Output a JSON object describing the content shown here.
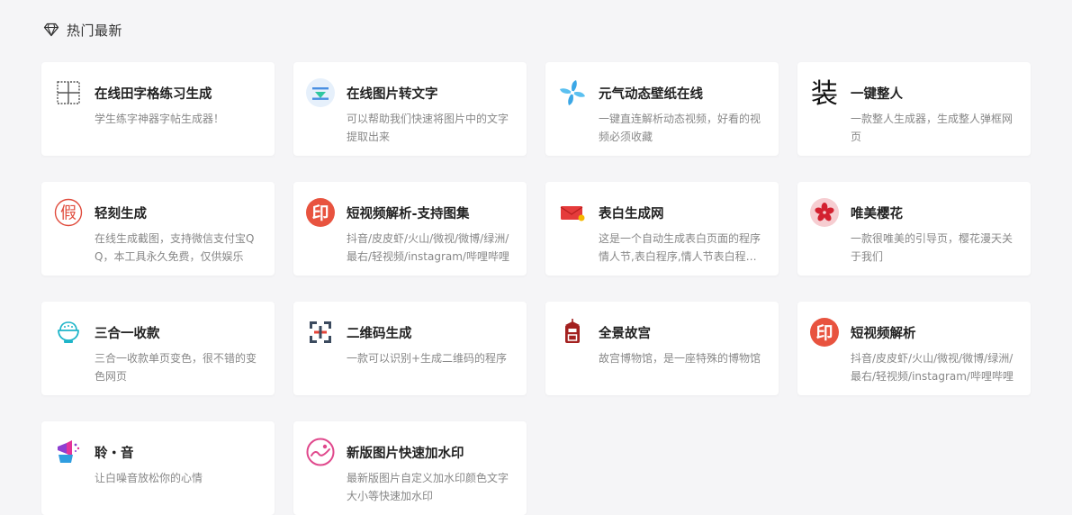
{
  "section": {
    "title": "热门最新",
    "icon": "diamond-icon"
  },
  "cards": [
    {
      "title": "在线田字格练习生成",
      "desc": "学生练字神器字帖生成器！",
      "icon": "grid-paper-icon"
    },
    {
      "title": "在线图片转文字",
      "desc": "可以帮助我们快速将图片中的文字提取出来",
      "icon": "image-to-text-icon"
    },
    {
      "title": "元气动态壁纸在线",
      "desc": "一键直连解析动态视频，好看的视频必须收藏",
      "icon": "pinwheel-icon"
    },
    {
      "title": "一键整人",
      "desc": "一款整人生成器，生成整人弹框网页",
      "icon": "zhuang-char-icon",
      "glyph": "装"
    },
    {
      "title": "轻刻生成",
      "desc": "在线生成截图，支持微信支付宝QQ，本工具永久免费，仅供娱乐",
      "icon": "jia-stamp-icon",
      "glyph": "假"
    },
    {
      "title": "短视频解析-支持图集",
      "desc": "抖音/皮皮虾/火山/微视/微博/绿洲/最右/轻视频/instagram/哔哩哔哩",
      "icon": "yin-stamp-icon",
      "glyph": "印"
    },
    {
      "title": "表白生成网",
      "desc": "这是一个自动生成表白页面的程序情人节,表白程序,情人节表白程序等",
      "icon": "envelope-icon"
    },
    {
      "title": "唯美樱花",
      "desc": "一款很唯美的引导页，樱花漫天关于我们",
      "icon": "sakura-icon"
    },
    {
      "title": "三合一收款",
      "desc": "三合一收款单页变色，很不错的变色网页",
      "icon": "bowl-icon"
    },
    {
      "title": "二维码生成",
      "desc": "一款可以识别+生成二维码的程序",
      "icon": "qrcode-icon"
    },
    {
      "title": "全景故宫",
      "desc": "故宫博物馆，是一座特殊的博物馆",
      "icon": "palace-lantern-icon"
    },
    {
      "title": "短视频解析",
      "desc": "抖音/皮皮虾/火山/微视/微博/绿洲/最右/轻视频/instagram/哔哩哔哩",
      "icon": "yin-stamp-icon",
      "glyph": "印"
    },
    {
      "title": "聆・音",
      "desc": "让白噪音放松你的心情",
      "icon": "megaphone-icon"
    },
    {
      "title": "新版图片快速加水印",
      "desc": "最新版图片自定义加水印颜色文字大小等快速加水印",
      "icon": "watermark-icon"
    }
  ]
}
